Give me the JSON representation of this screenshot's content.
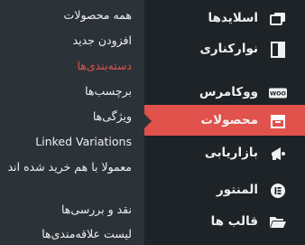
{
  "submenu": {
    "items": [
      {
        "label": "همه محصولات"
      },
      {
        "label": "افزودن جدید"
      },
      {
        "label": "دسته‌بندی‌ها"
      },
      {
        "label": "برچسب‌ها"
      },
      {
        "label": "ویژگی‌ها"
      },
      {
        "label": "Linked Variations"
      },
      {
        "label": "معمولا با هم خرید شده اند"
      },
      {
        "label": "نقد و بررسی‌ها"
      },
      {
        "label": "لیست علاقه‌مندی‌ها"
      }
    ]
  },
  "mainmenu": {
    "items": [
      {
        "label": "اسلایدها",
        "icon": "slides-icon"
      },
      {
        "label": "نوارکناری",
        "icon": "sidebar-icon"
      },
      {
        "label": "ووکامرس",
        "icon": "woocommerce-icon",
        "badge": "WOO"
      },
      {
        "label": "محصولات",
        "icon": "archive-box-icon"
      },
      {
        "label": "بازاریابی",
        "icon": "megaphone-icon"
      },
      {
        "label": "المنتور",
        "icon": "elementor-icon"
      },
      {
        "label": "قالب ها",
        "icon": "folder-open-icon"
      }
    ]
  },
  "colors": {
    "accent": "#e0524b",
    "submenu_bg": "#2c3338",
    "menu_bg": "#1d2327",
    "text": "#f0f0f1"
  }
}
